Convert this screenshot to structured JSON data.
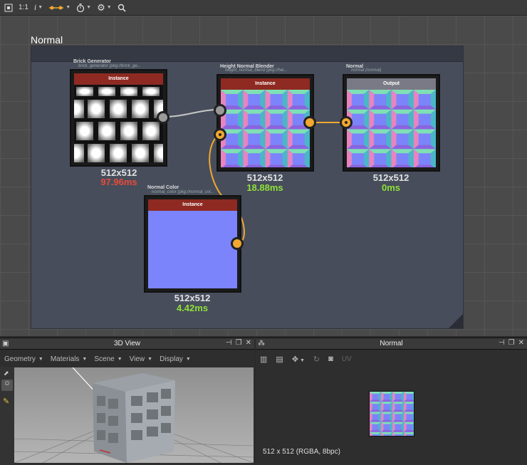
{
  "toolbar": {
    "items": [
      {
        "icon": "zoom-fit-icon",
        "label": ""
      },
      {
        "icon": "one-to-one-icon",
        "label": "1:1"
      },
      {
        "icon": "info-icon",
        "label": "i"
      },
      {
        "icon": "connection-style-icon",
        "label": ""
      },
      {
        "icon": "timer-icon",
        "label": ""
      },
      {
        "icon": "gear-icon",
        "label": ""
      },
      {
        "icon": "search-icon",
        "label": ""
      }
    ]
  },
  "graph": {
    "frame_title": "Normal",
    "nodes": {
      "brick": {
        "title": "Brick Generator",
        "subtitle": "brick_generator (pkg://brick_ge...",
        "bar": "Instance",
        "size": "512x512",
        "time": "97.96ms"
      },
      "blender": {
        "title": "Height Normal Blender",
        "subtitle": "height_normal_blend (pkg://hei...",
        "bar": "Instance",
        "size": "512x512",
        "time": "18.88ms"
      },
      "output": {
        "title": "Normal",
        "subtitle": "normal (normal)",
        "bar": "Output",
        "size": "512x512",
        "time": "0ms"
      },
      "color": {
        "title": "Normal Color",
        "subtitle": "normal_color (pkg://normal_col...",
        "bar": "Instance",
        "size": "512x512",
        "time": "4.42ms"
      }
    },
    "colors": {
      "time_slow": "#e84a3a",
      "time_fast": "#8fe03a",
      "bar_instance": "#8e2a22",
      "bar_output": "#7a7a86",
      "normal_flat": "#7c84fb",
      "port_orange": "#f0a830"
    }
  },
  "view3d": {
    "title": "3D View",
    "menus": [
      "Geometry",
      "Materials",
      "Scene",
      "View",
      "Display"
    ]
  },
  "preview2d": {
    "title": "Normal",
    "tools": [
      "image-icon",
      "paste-icon",
      "transform-icon",
      "redo-icon",
      "camera-icon"
    ],
    "uv_label": "UV",
    "info": "512 x 512 (RGBA, 8bpc)"
  }
}
